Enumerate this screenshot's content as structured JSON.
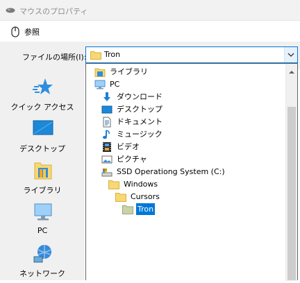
{
  "parent_window": {
    "title": "マウスのプロパティ"
  },
  "dialog": {
    "title": "参照"
  },
  "lookin": {
    "label": "ファイルの場所(I):",
    "value": "Tron"
  },
  "places": [
    {
      "label": "クイック アクセス",
      "icon": "quick-access-star-icon"
    },
    {
      "label": "デスクトップ",
      "icon": "desktop-icon"
    },
    {
      "label": "ライブラリ",
      "icon": "libraries-icon"
    },
    {
      "label": "PC",
      "icon": "pc-icon"
    },
    {
      "label": "ネットワーク",
      "icon": "network-icon"
    }
  ],
  "dropdown_items": [
    {
      "label": "ライブラリ",
      "icon": "libraries-icon",
      "level": 0
    },
    {
      "label": "PC",
      "icon": "pc-icon",
      "level": 0
    },
    {
      "label": "ダウンロード",
      "icon": "download-arrow-icon",
      "level": 1
    },
    {
      "label": "デスクトップ",
      "icon": "desktop-icon",
      "level": 1
    },
    {
      "label": "ドキュメント",
      "icon": "document-icon",
      "level": 1
    },
    {
      "label": "ミュージック",
      "icon": "music-note-icon",
      "level": 1
    },
    {
      "label": "ビデオ",
      "icon": "video-film-icon",
      "level": 1
    },
    {
      "label": "ピクチャ",
      "icon": "picture-icon",
      "level": 1
    },
    {
      "label": "SSD Operationg System (C:)",
      "icon": "drive-icon",
      "level": 1
    },
    {
      "label": "Windows",
      "icon": "folder-icon",
      "level": 2
    },
    {
      "label": "Cursors",
      "icon": "folder-icon",
      "level": 3
    },
    {
      "label": "Tron",
      "icon": "folder-icon",
      "level": 4,
      "selected": true
    }
  ],
  "colors": {
    "accent": "#0078d7",
    "folder": "#f8d775",
    "pane_bg": "#f0f0f0"
  }
}
